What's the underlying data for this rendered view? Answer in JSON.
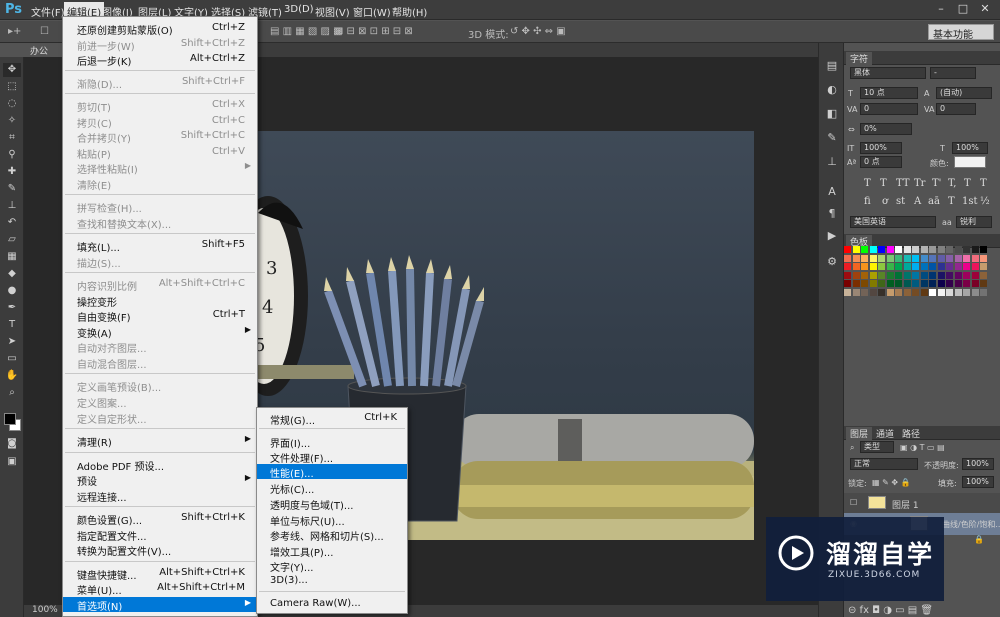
{
  "app": {
    "logo": "Ps",
    "menus": [
      "文件(F)",
      "编辑(E)",
      "图像(I)",
      "图层(L)",
      "文字(Y)",
      "选择(S)",
      "滤镜(T)",
      "3D(D)",
      "视图(V)",
      "窗口(W)",
      "帮助(H)"
    ],
    "window_buttons": [
      "–",
      "□",
      "✕"
    ]
  },
  "options_bar": {
    "mode_label": "3D 模式:",
    "workspace": "基本功能"
  },
  "document": {
    "tab_label": "办公2.jp",
    "zoom": "100%"
  },
  "edit_menu": {
    "items": [
      {
        "label": "还原创建剪贴蒙版(O)",
        "shortcut": "Ctrl+Z",
        "enabled": true
      },
      {
        "label": "前进一步(W)",
        "shortcut": "Shift+Ctrl+Z",
        "enabled": false
      },
      {
        "label": "后退一步(K)",
        "shortcut": "Alt+Ctrl+Z",
        "enabled": true
      },
      {
        "label": "渐隐(D)...",
        "shortcut": "Shift+Ctrl+F",
        "enabled": false
      },
      {
        "label": "剪切(T)",
        "shortcut": "Ctrl+X",
        "enabled": false
      },
      {
        "label": "拷贝(C)",
        "shortcut": "Ctrl+C",
        "enabled": false
      },
      {
        "label": "合并拷贝(Y)",
        "shortcut": "Shift+Ctrl+C",
        "enabled": false
      },
      {
        "label": "粘贴(P)",
        "shortcut": "Ctrl+V",
        "enabled": false
      },
      {
        "label": "选择性粘贴(I)",
        "shortcut": "",
        "enabled": false,
        "submenu": true
      },
      {
        "label": "清除(E)",
        "shortcut": "",
        "enabled": false
      },
      {
        "label": "拼写检查(H)...",
        "shortcut": "",
        "enabled": false
      },
      {
        "label": "查找和替换文本(X)...",
        "shortcut": "",
        "enabled": false
      },
      {
        "label": "填充(L)...",
        "shortcut": "Shift+F5",
        "enabled": true
      },
      {
        "label": "描边(S)...",
        "shortcut": "",
        "enabled": false
      },
      {
        "label": "内容识别比例",
        "shortcut": "Alt+Shift+Ctrl+C",
        "enabled": false
      },
      {
        "label": "操控变形",
        "shortcut": "",
        "enabled": true
      },
      {
        "label": "自由变换(F)",
        "shortcut": "Ctrl+T",
        "enabled": true
      },
      {
        "label": "变换(A)",
        "shortcut": "",
        "enabled": true,
        "submenu": true
      },
      {
        "label": "自动对齐图层...",
        "shortcut": "",
        "enabled": false
      },
      {
        "label": "自动混合图层...",
        "shortcut": "",
        "enabled": false
      },
      {
        "label": "定义画笔预设(B)...",
        "shortcut": "",
        "enabled": false
      },
      {
        "label": "定义图案...",
        "shortcut": "",
        "enabled": false
      },
      {
        "label": "定义自定形状...",
        "shortcut": "",
        "enabled": false
      },
      {
        "label": "清理(R)",
        "shortcut": "",
        "enabled": true,
        "submenu": true
      },
      {
        "label": "Adobe PDF 预设...",
        "shortcut": "",
        "enabled": true
      },
      {
        "label": "预设",
        "shortcut": "",
        "enabled": true,
        "submenu": true
      },
      {
        "label": "远程连接...",
        "shortcut": "",
        "enabled": true
      },
      {
        "label": "颜色设置(G)...",
        "shortcut": "Shift+Ctrl+K",
        "enabled": true
      },
      {
        "label": "指定配置文件...",
        "shortcut": "",
        "enabled": true
      },
      {
        "label": "转换为配置文件(V)...",
        "shortcut": "",
        "enabled": true
      },
      {
        "label": "键盘快捷键...",
        "shortcut": "Alt+Shift+Ctrl+K",
        "enabled": true
      },
      {
        "label": "菜单(U)...",
        "shortcut": "Alt+Shift+Ctrl+M",
        "enabled": true
      },
      {
        "label": "首选项(N)",
        "shortcut": "",
        "enabled": true,
        "submenu": true,
        "highlighted": true
      }
    ]
  },
  "prefs_menu": {
    "items": [
      {
        "label": "常规(G)...",
        "shortcut": "Ctrl+K"
      },
      {
        "label": "界面(I)...",
        "shortcut": ""
      },
      {
        "label": "文件处理(F)...",
        "shortcut": ""
      },
      {
        "label": "性能(E)...",
        "shortcut": "",
        "highlighted": true
      },
      {
        "label": "光标(C)...",
        "shortcut": ""
      },
      {
        "label": "透明度与色域(T)...",
        "shortcut": ""
      },
      {
        "label": "单位与标尺(U)...",
        "shortcut": ""
      },
      {
        "label": "参考线、网格和切片(S)...",
        "shortcut": ""
      },
      {
        "label": "增效工具(P)...",
        "shortcut": ""
      },
      {
        "label": "文字(Y)...",
        "shortcut": ""
      },
      {
        "label": "3D(3)...",
        "shortcut": ""
      },
      {
        "label": "Camera Raw(W)...",
        "shortcut": ""
      }
    ]
  },
  "character_panel": {
    "tab": "字符",
    "font_family": "黑体",
    "font_size": "10 点",
    "leading": "(自动)",
    "kerning": "0",
    "tracking": "0%",
    "vertical_scale": "100%",
    "horizontal_scale": "100%",
    "baseline_shift": "0 点",
    "color_label": "颜色:",
    "style_buttons": [
      "T",
      "T",
      "TT",
      "Tr",
      "T'",
      "T,",
      "T",
      "T"
    ],
    "opentype_buttons": [
      "fi",
      "ơ",
      "st",
      "A",
      "aā",
      "T",
      "1st",
      "½"
    ],
    "language": "美国英语",
    "antialias": "锐利"
  },
  "swatches_panel": {
    "tab": "色板"
  },
  "layers_panel": {
    "tabs": [
      "图层",
      "通道",
      "路径"
    ],
    "filter_label": "类型",
    "blend_mode": "正常",
    "opacity_label": "不透明度:",
    "opacity": "100%",
    "fill_label": "填充:",
    "fill": "100%",
    "lock_label": "锁定:",
    "layers": [
      {
        "name": "图层 1"
      },
      {
        "name": "曲线/色阶/饱和..."
      }
    ]
  },
  "watermark": {
    "title": "溜溜自学",
    "url": "ZIXUE.3D66.COM"
  },
  "colors": {
    "menu_highlight": "#0078d7",
    "ps_blue": "#4eb6e6"
  }
}
